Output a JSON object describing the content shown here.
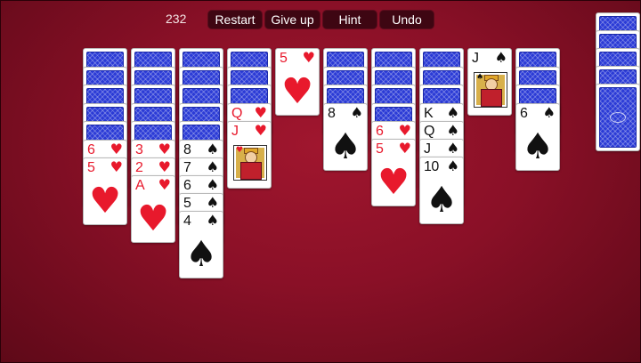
{
  "score": "232",
  "toolbar": {
    "restart_label": "Restart",
    "give_up_label": "Give up",
    "hint_label": "Hint",
    "undo_label": "Undo"
  },
  "colors": {
    "felt": "#8a1027",
    "button_bg": "#3e0612",
    "card_back": "#2b3bd6",
    "red_suit": "#e8192c",
    "black_suit": "#111111"
  },
  "tableau": [
    {
      "down": 5,
      "up": [
        {
          "rank": "6",
          "suit": "hearts"
        },
        {
          "rank": "5",
          "suit": "hearts"
        }
      ]
    },
    {
      "down": 5,
      "up": [
        {
          "rank": "3",
          "suit": "hearts"
        },
        {
          "rank": "2",
          "suit": "hearts"
        },
        {
          "rank": "A",
          "suit": "hearts"
        }
      ]
    },
    {
      "down": 5,
      "up": [
        {
          "rank": "8",
          "suit": "spades"
        },
        {
          "rank": "7",
          "suit": "spades"
        },
        {
          "rank": "6",
          "suit": "spades"
        },
        {
          "rank": "5",
          "suit": "spades"
        },
        {
          "rank": "4",
          "suit": "spades"
        }
      ]
    },
    {
      "down": 3,
      "up": [
        {
          "rank": "Q",
          "suit": "hearts"
        },
        {
          "rank": "J",
          "suit": "hearts"
        }
      ]
    },
    {
      "down": 0,
      "up": [
        {
          "rank": "5",
          "suit": "hearts"
        }
      ]
    },
    {
      "down": 3,
      "up": [
        {
          "rank": "8",
          "suit": "spades"
        }
      ]
    },
    {
      "down": 4,
      "up": [
        {
          "rank": "6",
          "suit": "hearts"
        },
        {
          "rank": "5",
          "suit": "hearts"
        }
      ]
    },
    {
      "down": 3,
      "up": [
        {
          "rank": "K",
          "suit": "spades"
        },
        {
          "rank": "Q",
          "suit": "spades"
        },
        {
          "rank": "J",
          "suit": "spades"
        },
        {
          "rank": "10",
          "suit": "spades"
        }
      ]
    },
    {
      "down": 0,
      "up": [
        {
          "rank": "J",
          "suit": "spades"
        }
      ]
    },
    {
      "down": 3,
      "up": [
        {
          "rank": "6",
          "suit": "spades"
        }
      ]
    }
  ],
  "stock_piles": 5
}
